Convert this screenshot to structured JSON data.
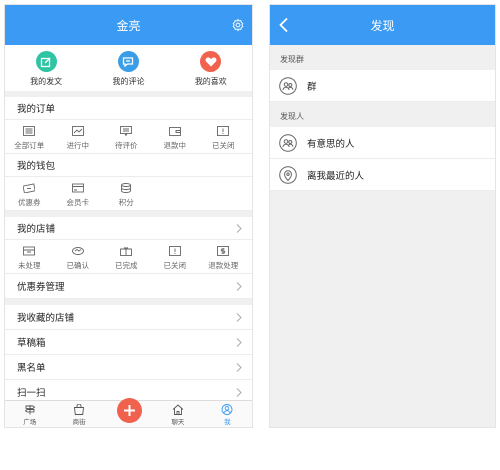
{
  "left": {
    "title": "金亮",
    "quick": [
      {
        "label": "我的发文",
        "color": "#2fc4a4",
        "icon": "edit-icon"
      },
      {
        "label": "我的评论",
        "color": "#3a9ee6",
        "icon": "chat-icon"
      },
      {
        "label": "我的喜欢",
        "color": "#f0624e",
        "icon": "heart-icon"
      }
    ],
    "orders": {
      "title": "我的订单",
      "items": [
        {
          "label": "全部订单",
          "icon": "list-icon"
        },
        {
          "label": "进行中",
          "icon": "trend-icon"
        },
        {
          "label": "待评价",
          "icon": "comment-icon"
        },
        {
          "label": "退款中",
          "icon": "wallet-icon"
        },
        {
          "label": "已关闭",
          "icon": "alert-icon"
        }
      ]
    },
    "wallet": {
      "title": "我的钱包",
      "items": [
        {
          "label": "优惠券",
          "icon": "coupon-icon"
        },
        {
          "label": "会员卡",
          "icon": "card-icon"
        },
        {
          "label": "积分",
          "icon": "coins-icon"
        }
      ]
    },
    "shop": {
      "title": "我的店铺",
      "items": [
        {
          "label": "未处理",
          "icon": "inbox-icon"
        },
        {
          "label": "已确认",
          "icon": "handshake-icon"
        },
        {
          "label": "已完成",
          "icon": "gift-icon"
        },
        {
          "label": "已关闭",
          "icon": "alert-icon"
        },
        {
          "label": "退款处理",
          "icon": "dollar-icon"
        }
      ],
      "coupon_manage": "优惠券管理"
    },
    "list": [
      "我收藏的店铺",
      "草稿箱",
      "黑名单",
      "扫一扫"
    ],
    "tabs": [
      {
        "label": "广场",
        "icon": "signpost-icon"
      },
      {
        "label": "商街",
        "icon": "bag-icon"
      },
      {
        "label": "",
        "icon": "plus-icon"
      },
      {
        "label": "聊天",
        "icon": "house-icon"
      },
      {
        "label": "我",
        "icon": "person-icon"
      }
    ]
  },
  "right": {
    "title": "发现",
    "groups_label": "发现群",
    "groups": [
      {
        "label": "群",
        "icon": "group-icon"
      }
    ],
    "people_label": "发现人",
    "people": [
      {
        "label": "有意思的人",
        "icon": "people-icon"
      },
      {
        "label": "离我最近的人",
        "icon": "location-icon"
      }
    ]
  },
  "colors": {
    "accent": "#3b9af3",
    "plus": "#f0624e"
  }
}
